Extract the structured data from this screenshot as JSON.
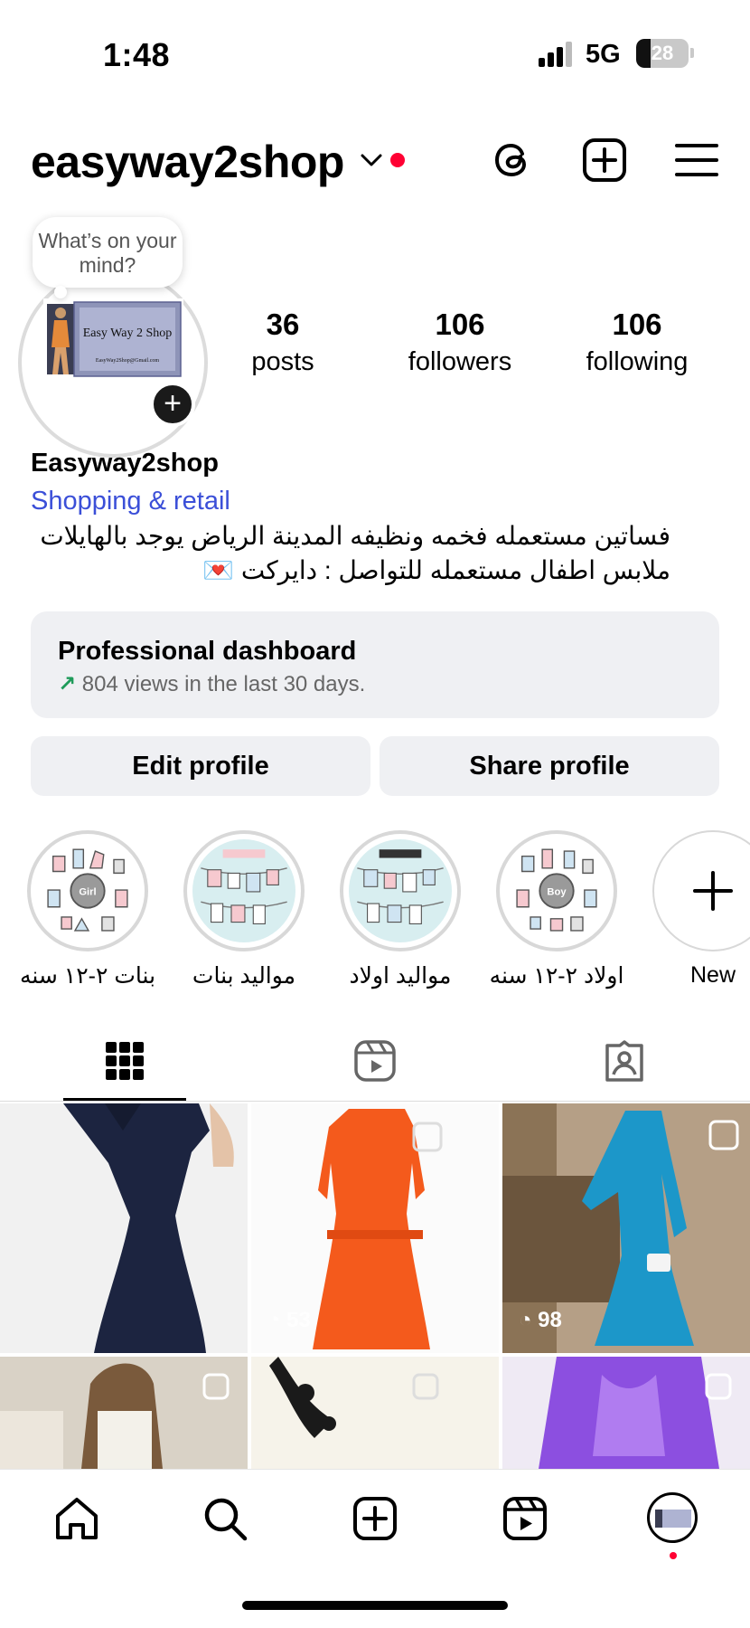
{
  "status_bar": {
    "time": "1:48",
    "network": "5G",
    "battery": "28",
    "battery_fraction": 0.28
  },
  "header": {
    "username": "easyway2shop"
  },
  "note": {
    "text": "What’s on your mind?"
  },
  "avatar": {
    "title": "Easy Way 2 Shop",
    "email": "EasyWay2Shop@Gmail.com"
  },
  "stats": [
    {
      "value": "36",
      "label": "posts"
    },
    {
      "value": "106",
      "label": "followers"
    },
    {
      "value": "106",
      "label": "following"
    }
  ],
  "profile": {
    "display_name": "Easyway2shop",
    "category": "Shopping & retail",
    "bio_line1": "فساتين مستعمله فخمه ونظيفه المدينة الرياض يوجد بالهايلات",
    "bio_line2": "ملابس اطفال مستعمله للتواصل : دايركت 💌"
  },
  "dashboard": {
    "title": "Professional dashboard",
    "arrow": "↗",
    "subtitle": "804 views in the last 30 days."
  },
  "buttons": {
    "edit": "Edit profile",
    "share": "Share profile"
  },
  "highlights": [
    {
      "label": "بنات ٢-١٢ سنه",
      "badge": "Girl"
    },
    {
      "label": "مواليد بنات",
      "badge": ""
    },
    {
      "label": "مواليد اولاد",
      "badge": ""
    },
    {
      "label": "اولاد ٢-١٢ سنه",
      "badge": "Boy"
    },
    {
      "label": "New",
      "badge": ""
    }
  ],
  "posts": [
    {
      "views": "",
      "multi": false
    },
    {
      "views": "53",
      "multi": true
    },
    {
      "views": "98",
      "multi": true
    },
    {
      "views": "",
      "multi": true
    },
    {
      "views": "",
      "multi": true
    },
    {
      "views": "",
      "multi": true
    }
  ],
  "colors": {
    "accent_link": "#3b4fd8",
    "notification": "#ff0033",
    "trend_green": "#1f9b5a"
  },
  "icons": [
    "threads-icon",
    "create-post-icon",
    "menu-icon",
    "grid-icon",
    "reels-icon",
    "tagged-icon",
    "home-icon",
    "search-icon",
    "reels-nav-icon"
  ]
}
